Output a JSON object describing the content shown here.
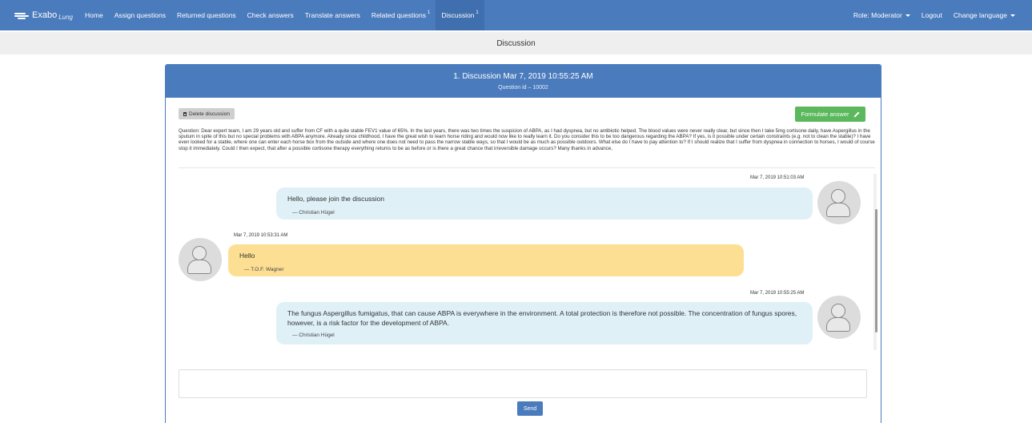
{
  "navbar": {
    "brand": "Exabo",
    "brand_sub": "Lung",
    "items": [
      {
        "label": "Home",
        "badge": ""
      },
      {
        "label": "Assign questions",
        "badge": ""
      },
      {
        "label": "Returned questions",
        "badge": ""
      },
      {
        "label": "Check answers",
        "badge": ""
      },
      {
        "label": "Translate answers",
        "badge": ""
      },
      {
        "label": "Related questions",
        "badge": "1"
      },
      {
        "label": "Discussion",
        "badge": "1"
      }
    ],
    "active_item": "Discussion",
    "role": "Role: Moderator",
    "logout": "Logout",
    "language": "Change language",
    "color": "#4a7bbd"
  },
  "subheader": {
    "title": "Discussion"
  },
  "panel": {
    "title": "1. Discussion Mar 7, 2019 10:55:25 AM",
    "subtitle": "Question id – 10002",
    "delete_label": "Delete discussion",
    "formulate_label": "Formulate answer",
    "question": "Question: Dear expert team, I am 29 years old and suffer from CF with a quite stable FEV1 value of 65%. In the last years, there was two times the suspicion of ABPA, as I had dyspnea, but no antibiotic helped. The blood values were never really clear, but since then I take 5mg cortisone daily, have Aspergillus in the sputum in spite of this but no special problems with ABPA anymore. Already since childhood, I have the great wish to learn horse riding and would now like to really learn it. Do you consider this to be too dangerous regarding the ABPA? If yes, is it possible under certain constraints (e.g. not to clean the stable)? I have even looked for a stable, where one can enter each horse box from the outside and where one does not need to pass the narrow stable ways, so that I would be as much as possible outdoors. What else do I have to pay attention to? If I should realize that I suffer from dyspnea in connection to horses, I would of course stop it immediately. Could I then expect, that after a possible cortisone therapy everything returns to be as before or is there a great chance that irreversible damage occurs? Many thanks in advance,"
  },
  "messages": [
    {
      "timestamp": "Mar 7, 2019 10:51:03 AM",
      "text": "Hello, please join the discussion",
      "author": "— Christian Hügel",
      "side": "right",
      "color": "#dff0f7"
    },
    {
      "timestamp": "Mar 7, 2019 10:53:31 AM",
      "text": "Hello",
      "author": "— T.O.F. Wagner",
      "side": "left",
      "color": "#fddf93"
    },
    {
      "timestamp": "Mar 7, 2019 10:55:25 AM",
      "text": "The fungus Aspergillus fumigatus, that can cause ABPA is everywhere in the environment. A total protection is therefore not possible. The concentration of fungus spores, however, is a risk factor for the development of ABPA.",
      "author": "— Christian Hügel",
      "side": "right",
      "color": "#dff0f7"
    }
  ],
  "reply": {
    "placeholder": "",
    "send_label": "Send"
  }
}
